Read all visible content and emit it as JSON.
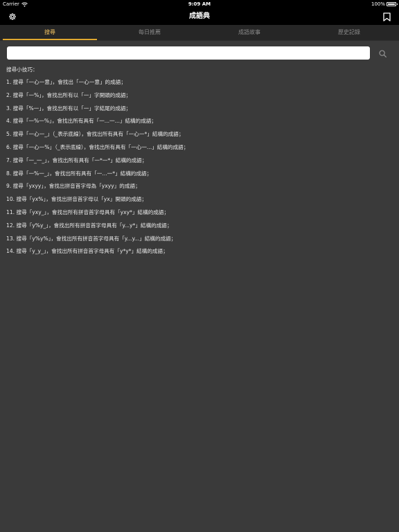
{
  "status_bar": {
    "carrier": "Carrier",
    "time": "9:09 AM",
    "battery": "100%"
  },
  "nav": {
    "title": "成語典",
    "left_icon": "gear-icon",
    "right_icon": "bookmark-icon"
  },
  "tabs": [
    {
      "label": "搜尋",
      "active": true
    },
    {
      "label": "每日推薦",
      "active": false
    },
    {
      "label": "成語故事",
      "active": false
    },
    {
      "label": "歷史記錄",
      "active": false
    }
  ],
  "search": {
    "value": "",
    "icon": "search-icon"
  },
  "tips": {
    "title": "搜尋小技巧：",
    "items": [
      "1. 搜尋「一心一意」，會找出「一心一意」的成語；",
      "2. 搜尋「一%」，會找出所有以「一」字開頭的成語；",
      "3. 搜尋「%一」，會找出所有以「一」字結尾的成語；",
      "4. 搜尋「一%一%」，會找出所有具有「一...一...」結構的成語；",
      "5. 搜尋「一心一_」（_表示底線），會找出所有具有「一心一*」結構的成語；",
      "6. 搜尋「一心一%」（_表示底線），會找出所有具有「一心一...」結構的成語；",
      "7. 搜尋「一_一_」，會找出所有具有「一*一*」結構的成語；",
      "8. 搜尋「一%一_」，會找出所有具有「一...一*」結構的成語；",
      "9. 搜尋「yxyy」，會找出拼音首字母為「yxyy」的成語；",
      "10. 搜尋「yx%」，會找出拼音首字母以「yx」開頭的成語；",
      "11. 搜尋「yxy_」，會找出所有拼音首字母具有「yxy*」結構的成語；",
      "12. 搜尋「y%y_」，會找出所有拼音首字母具有「y...y*」結構的成語；",
      "13. 搜尋「y%y%」，會找出所有拼音首字母具有「y...y...」結構的成語；",
      "14. 搜尋「y_y_」，會找出所有拼音首字母具有「y*y*」結構的成語；"
    ]
  }
}
